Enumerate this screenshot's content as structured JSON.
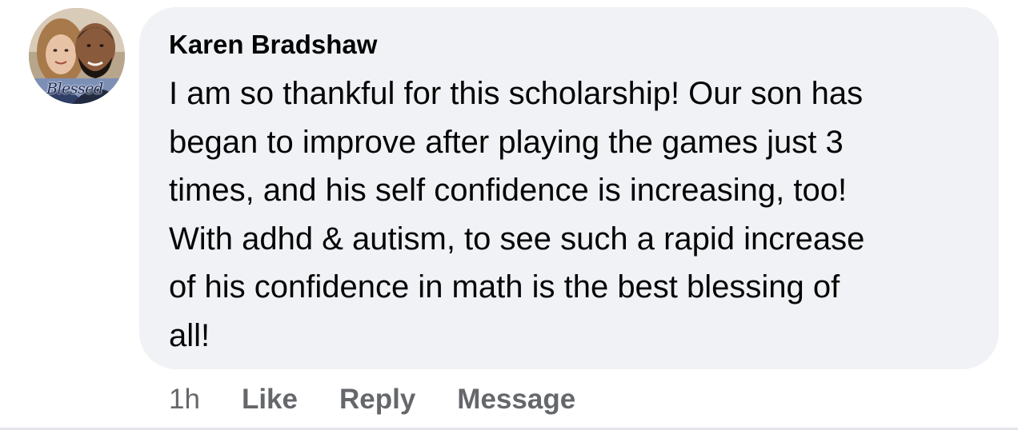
{
  "comment": {
    "avatar": {
      "caption": "Blessed"
    },
    "author": "Karen Bradshaw",
    "text": "I am so thankful for this scholarship! Our son has\nbegan to improve after playing the games just 3\ntimes, and his self confidence is increasing, too!\nWith adhd & autism, to see such a rapid increase\nof his confidence in math is the best blessing of\nall!",
    "timestamp": "1h",
    "actions": {
      "like": "Like",
      "reply": "Reply",
      "message": "Message"
    }
  },
  "colors": {
    "bubble_background": "#f0f2f5",
    "text_primary": "#050505",
    "text_secondary": "#65676b"
  }
}
